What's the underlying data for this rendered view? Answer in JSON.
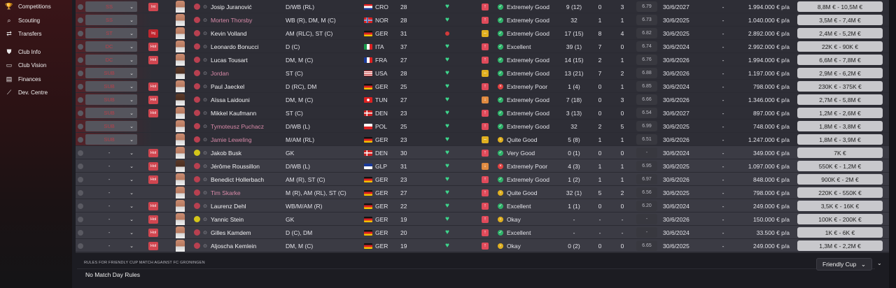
{
  "sidebar": {
    "items": [
      {
        "label": "Competitions",
        "icon": "trophy-icon",
        "glyph": "🏆"
      },
      {
        "label": "Scouting",
        "icon": "scouting-icon",
        "glyph": "⌕"
      },
      {
        "label": "Transfers",
        "icon": "transfers-icon",
        "glyph": "⇄"
      },
      {
        "label": "Club Info",
        "icon": "shield-icon",
        "glyph": "⛊"
      },
      {
        "label": "Club Vision",
        "icon": "vision-icon",
        "glyph": "▭"
      },
      {
        "label": "Finances",
        "icon": "finances-icon",
        "glyph": "▤"
      },
      {
        "label": "Dev. Centre",
        "icon": "dev-centre-icon",
        "glyph": "⟋"
      }
    ]
  },
  "players": [
    {
      "sel": "SS",
      "status": "Int",
      "role": "",
      "name": "Josip Juranović",
      "link": false,
      "pos": "D/WB (RL)",
      "flag": "CRO",
      "nat": "CRO",
      "age": "28",
      "heart": "heart",
      "morale": "up",
      "cond": "ok",
      "cond_text": "Extremely Good",
      "apps": "9 (12)",
      "gls": "0",
      "ast": "3",
      "rat": "6.79",
      "exp": "30/6/2027",
      "dash": "-",
      "wage": "1.994.000 € p/a",
      "value": "8,8M € - 10,5M €",
      "row": "reserve",
      "dark": false
    },
    {
      "sel": "SS",
      "status": "",
      "role": "",
      "name": "Morten Thorsby",
      "link": true,
      "pos": "WB (R), DM, M (C)",
      "flag": "NOR",
      "nat": "NOR",
      "age": "28",
      "heart": "heart",
      "morale": "up",
      "cond": "ok",
      "cond_text": "Extremely Good",
      "apps": "32",
      "gls": "1",
      "ast": "1",
      "rat": "6.73",
      "exp": "30/6/2025",
      "dash": "-",
      "wage": "1.040.000 € p/a",
      "value": "3,5M € - 7,4M €",
      "row": "reserve",
      "dark": false
    },
    {
      "sel": "ST",
      "status": "Inj",
      "role": "",
      "name": "Kevin Volland",
      "link": false,
      "pos": "AM (RLC), ST (C)",
      "flag": "GER",
      "nat": "GER",
      "age": "31",
      "heart": "dot",
      "morale": "neutral",
      "cond": "ok",
      "cond_text": "Extremely Good",
      "apps": "17 (15)",
      "gls": "8",
      "ast": "4",
      "rat": "6.82",
      "exp": "30/6/2025",
      "dash": "-",
      "wage": "2.892.000 € p/a",
      "value": "2,4M € - 5,2M €",
      "row": "reserve",
      "dark": false
    },
    {
      "sel": "DC",
      "status": "Hol",
      "role": "",
      "name": "Leonardo Bonucci",
      "link": false,
      "pos": "D (C)",
      "flag": "ITA",
      "nat": "ITA",
      "age": "37",
      "heart": "heart",
      "morale": "up",
      "cond": "ok",
      "cond_text": "Excellent",
      "apps": "39 (1)",
      "gls": "7",
      "ast": "0",
      "rat": "6.74",
      "exp": "30/6/2024",
      "dash": "-",
      "wage": "2.992.000 € p/a",
      "value": "22K € - 90K €",
      "row": "reserve",
      "dark": false
    },
    {
      "sel": "DC",
      "status": "Hol",
      "role": "",
      "name": "Lucas Tousart",
      "link": false,
      "pos": "DM, M (C)",
      "flag": "FRA",
      "nat": "FRA",
      "age": "27",
      "heart": "heart",
      "morale": "up",
      "cond": "ok",
      "cond_text": "Extremely Good",
      "apps": "14 (15)",
      "gls": "2",
      "ast": "1",
      "rat": "6.76",
      "exp": "30/6/2026",
      "dash": "-",
      "wage": "1.994.000 € p/a",
      "value": "6,6M € - 7,8M €",
      "row": "reserve",
      "dark": false
    },
    {
      "sel": "SUB",
      "status": "",
      "role": "",
      "name": "Jordan",
      "link": true,
      "pos": "ST (C)",
      "flag": "USA",
      "nat": "USA",
      "age": "28",
      "heart": "heart",
      "morale": "neutral",
      "cond": "ok",
      "cond_text": "Extremely Good",
      "apps": "13 (21)",
      "gls": "7",
      "ast": "2",
      "rat": "6.88",
      "exp": "30/6/2026",
      "dash": "-",
      "wage": "1.197.000 € p/a",
      "value": "2,9M € - 6,2M €",
      "row": "reserve",
      "dark": true
    },
    {
      "sel": "SUB",
      "status": "Hol",
      "role": "",
      "name": "Paul Jaeckel",
      "link": false,
      "pos": "D (RC), DM",
      "flag": "GER",
      "nat": "GER",
      "age": "25",
      "heart": "heart",
      "morale": "up",
      "cond": "bad",
      "cond_text": "Extremely Poor",
      "apps": "1 (4)",
      "gls": "0",
      "ast": "1",
      "rat": "6.85",
      "exp": "30/6/2024",
      "dash": "-",
      "wage": "798.000 € p/a",
      "value": "230K € - 375K €",
      "row": "reserve",
      "dark": false
    },
    {
      "sel": "SUB",
      "status": "Hol",
      "role": "",
      "name": "Aïssa Laidouni",
      "link": false,
      "pos": "DM, M (C)",
      "flag": "TUN",
      "nat": "TUN",
      "age": "27",
      "heart": "heart",
      "morale": "down",
      "cond": "ok",
      "cond_text": "Extremely Good",
      "apps": "7 (18)",
      "gls": "0",
      "ast": "3",
      "rat": "6.66",
      "exp": "30/6/2026",
      "dash": "-",
      "wage": "1.346.000 € p/a",
      "value": "2,7M € - 5,8M €",
      "row": "reserve",
      "dark": true
    },
    {
      "sel": "SUB",
      "status": "Hol",
      "role": "",
      "name": "Mikkel Kaufmann",
      "link": false,
      "pos": "ST (C)",
      "flag": "DEN",
      "nat": "DEN",
      "age": "23",
      "heart": "heart",
      "morale": "up",
      "cond": "ok",
      "cond_text": "Extremely Good",
      "apps": "3 (13)",
      "gls": "0",
      "ast": "0",
      "rat": "6.54",
      "exp": "30/6/2027",
      "dash": "-",
      "wage": "897.000 € p/a",
      "value": "1,2M € - 2,6M €",
      "row": "reserve",
      "dark": false
    },
    {
      "sel": "SUB",
      "status": "",
      "role": "",
      "name": "Tymoteusz Puchacz",
      "link": true,
      "pos": "D/WB (L)",
      "flag": "POL",
      "nat": "POL",
      "age": "25",
      "heart": "heart",
      "morale": "up",
      "cond": "ok",
      "cond_text": "Extremely Good",
      "apps": "32",
      "gls": "2",
      "ast": "5",
      "rat": "6.99",
      "exp": "30/6/2025",
      "dash": "-",
      "wage": "748.000 € p/a",
      "value": "1,8M € - 3,8M €",
      "row": "reserve",
      "dark": false
    },
    {
      "sel": "SUB",
      "status": "",
      "role": "",
      "name": "Jamie Leweling",
      "link": true,
      "pos": "M/AM (RL)",
      "flag": "GER",
      "nat": "GER",
      "age": "23",
      "heart": "heart",
      "morale": "neutral",
      "cond": "warn",
      "cond_text": "Quite Good",
      "apps": "5 (8)",
      "gls": "1",
      "ast": "1",
      "rat": "6.51",
      "exp": "30/6/2026",
      "dash": "-",
      "wage": "1.247.000 € p/a",
      "value": "1,8M € - 3,9M €",
      "row": "reserve",
      "dark": false
    },
    {
      "sel": "-",
      "status": "Hol",
      "role": "GK",
      "name": "Jakob Busk",
      "link": false,
      "pos": "GK",
      "flag": "DEN",
      "nat": "DEN",
      "age": "30",
      "heart": "heart",
      "morale": "up",
      "cond": "ok",
      "cond_text": "Very Good",
      "apps": "0 (1)",
      "gls": "0",
      "ast": "0",
      "rat": "-",
      "exp": "30/6/2024",
      "dash": "-",
      "wage": "349.000 € p/a",
      "value": "7K €",
      "row": "youth",
      "dark": false
    },
    {
      "sel": "-",
      "status": "Hol",
      "role": "",
      "name": "Jérôme Roussillon",
      "link": false,
      "pos": "D/WB (L)",
      "flag": "GLP",
      "nat": "GLP",
      "age": "31",
      "heart": "heart",
      "morale": "down",
      "cond": "bad",
      "cond_text": "Extremely Poor",
      "apps": "4 (3)",
      "gls": "1",
      "ast": "1",
      "rat": "6.95",
      "exp": "30/6/2025",
      "dash": "-",
      "wage": "1.097.000 € p/a",
      "value": "550K € - 1,2M €",
      "row": "youth",
      "dark": true
    },
    {
      "sel": "-",
      "status": "Hol",
      "role": "",
      "name": "Benedict Hollerbach",
      "link": false,
      "pos": "AM (R), ST (C)",
      "flag": "GER",
      "nat": "GER",
      "age": "23",
      "heart": "heart",
      "morale": "up",
      "cond": "ok",
      "cond_text": "Extremely Good",
      "apps": "1 (2)",
      "gls": "1",
      "ast": "1",
      "rat": "6.97",
      "exp": "30/6/2026",
      "dash": "-",
      "wage": "848.000 € p/a",
      "value": "900K € - 2M €",
      "row": "youth",
      "dark": false
    },
    {
      "sel": "-",
      "status": "",
      "role": "",
      "name": "Tim Skarke",
      "link": true,
      "pos": "M (R), AM (RL), ST (C)",
      "flag": "GER",
      "nat": "GER",
      "age": "27",
      "heart": "heart",
      "morale": "up",
      "cond": "warn",
      "cond_text": "Quite Good",
      "apps": "32 (1)",
      "gls": "5",
      "ast": "2",
      "rat": "6.56",
      "exp": "30/6/2025",
      "dash": "-",
      "wage": "798.000 € p/a",
      "value": "220K € - 550K €",
      "row": "youth",
      "dark": false
    },
    {
      "sel": "-",
      "status": "Hol",
      "role": "",
      "name": "Laurenz Dehl",
      "link": false,
      "pos": "WB/M/AM (R)",
      "flag": "GER",
      "nat": "GER",
      "age": "22",
      "heart": "heart",
      "morale": "up",
      "cond": "ok",
      "cond_text": "Excellent",
      "apps": "1 (1)",
      "gls": "0",
      "ast": "0",
      "rat": "6.20",
      "exp": "30/6/2024",
      "dash": "-",
      "wage": "249.000 € p/a",
      "value": "3,5K € - 16K €",
      "row": "youth",
      "dark": false
    },
    {
      "sel": "-",
      "status": "Hol",
      "role": "GK",
      "name": "Yannic Stein",
      "link": false,
      "pos": "GK",
      "flag": "GER",
      "nat": "GER",
      "age": "19",
      "heart": "heart",
      "morale": "up",
      "cond": "warn",
      "cond_text": "Okay",
      "apps": "-",
      "gls": "-",
      "ast": "-",
      "rat": "-",
      "exp": "30/6/2026",
      "dash": "-",
      "wage": "150.000 € p/a",
      "value": "100K € - 200K €",
      "row": "youth",
      "dark": false
    },
    {
      "sel": "-",
      "status": "Hol",
      "role": "",
      "name": "Gilles Kamdem",
      "link": false,
      "pos": "D (C), DM",
      "flag": "GER",
      "nat": "GER",
      "age": "20",
      "heart": "heart",
      "morale": "up",
      "cond": "ok",
      "cond_text": "Excellent",
      "apps": "-",
      "gls": "-",
      "ast": "-",
      "rat": "-",
      "exp": "30/6/2024",
      "dash": "-",
      "wage": "33.500 € p/a",
      "value": "1K € - 6K €",
      "row": "youth",
      "dark": false
    },
    {
      "sel": "-",
      "status": "Hol",
      "role": "",
      "name": "Aljoscha Kemlein",
      "link": false,
      "pos": "DM, M (C)",
      "flag": "GER",
      "nat": "GER",
      "age": "19",
      "heart": "heart",
      "morale": "up",
      "cond": "warn",
      "cond_text": "Okay",
      "apps": "0 (2)",
      "gls": "0",
      "ast": "0",
      "rat": "6.65",
      "exp": "30/6/2025",
      "dash": "-",
      "wage": "249.000 € p/a",
      "value": "1,3M € - 2,2M €",
      "row": "youth",
      "dark": false
    }
  ],
  "bottom": {
    "rules_label": "RULES FOR FRIENDLY CUP MATCH AGAINST FC GRONINGEN",
    "rules_text": "No Match Day Rules",
    "competition": "Friendly Cup"
  },
  "colors": {
    "accent_red": "#d04650",
    "good_green": "#3dd68c",
    "warn_yellow": "#e0b020",
    "bad_red": "#e04040"
  }
}
